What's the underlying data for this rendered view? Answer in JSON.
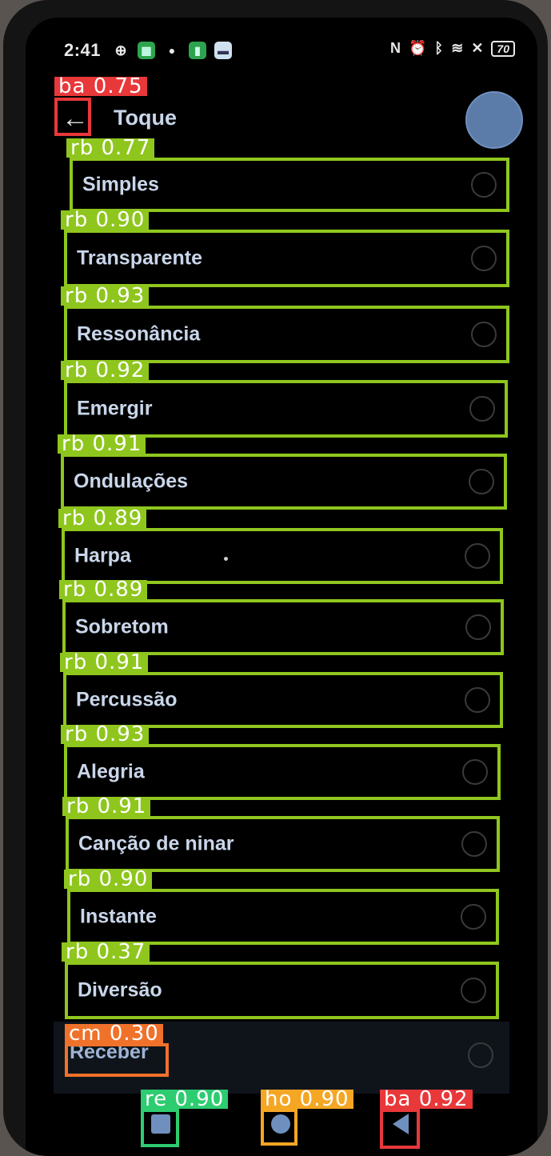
{
  "status_bar": {
    "time": "2:41",
    "battery": "70",
    "nfc_glyph": "N",
    "alarm_glyph": "⏰",
    "bluetooth_glyph": "ᛒ",
    "wifi_glyph": "≋",
    "close_glyph": "✕"
  },
  "header": {
    "title": "Toque",
    "back_glyph": "←"
  },
  "ringtones": [
    {
      "label": "Simples"
    },
    {
      "label": "Transparente"
    },
    {
      "label": "Ressonância"
    },
    {
      "label": "Emergir"
    },
    {
      "label": "Ondulações"
    },
    {
      "label": "Harpa"
    },
    {
      "label": "Sobretom"
    },
    {
      "label": "Percussão"
    },
    {
      "label": "Alegria"
    },
    {
      "label": "Canção de ninar"
    },
    {
      "label": "Instante"
    },
    {
      "label": "Diversão"
    }
  ],
  "receive": {
    "label": "Receber"
  },
  "detections": {
    "back_top": "ba 0.75",
    "rb": [
      "rb 0.77",
      "rb 0.90",
      "rb 0.93",
      "rb 0.92",
      "rb 0.91",
      "rb 0.89",
      "rb 0.89",
      "rb 0.91",
      "rb 0.93",
      "rb 0.91",
      "rb 0.90",
      "rb 0.37"
    ],
    "cm": "cm 0.30",
    "recents": "re 0.90",
    "home": "ho 0.90",
    "back_nav": "ba 0.92"
  },
  "colors": {
    "radio_box": "#8fc61e",
    "back_box": "#e8383a",
    "cm_box": "#f0722a",
    "home_box": "#f5a623",
    "recents_box": "#2ecc71",
    "accent": "#6f8fbf"
  }
}
